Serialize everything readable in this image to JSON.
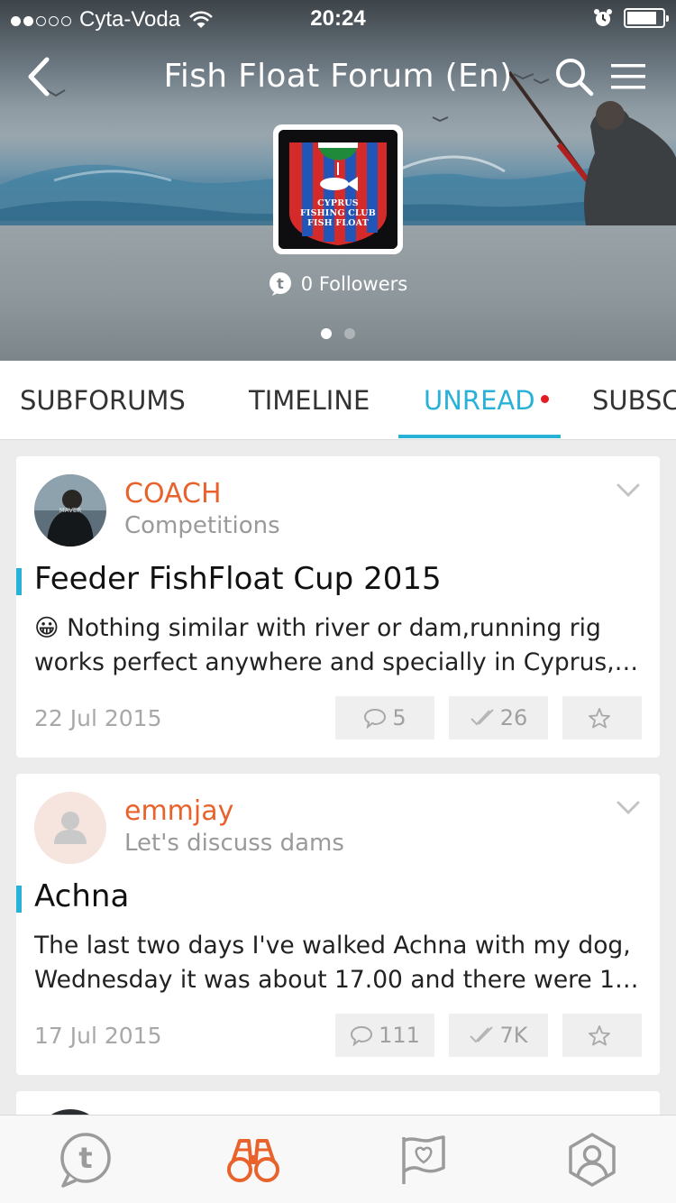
{
  "status_bar": {
    "carrier": "Cyta-Voda",
    "time": "20:24",
    "signal_bars_filled": 2,
    "signal_bars_total": 5,
    "battery_level": 0.85
  },
  "nav": {
    "title": "Fish Float Forum (En)",
    "back_icon": "chevron-left-icon",
    "search_icon": "search-icon",
    "menu_icon": "hamburger-menu-icon"
  },
  "forum": {
    "logo_text_lines": [
      "CYPRUS",
      "FISHING CLUB",
      "FISH FLOAT"
    ],
    "followers_label": "0 Followers",
    "pager_pages": 2,
    "pager_active": 0
  },
  "tabs": [
    {
      "label": "SUBFORUMS"
    },
    {
      "label": "TIMELINE"
    },
    {
      "label": "UNREAD",
      "active": true,
      "has_dot": true
    },
    {
      "label": "SUBSCRIBED"
    }
  ],
  "topics": [
    {
      "author": "COACH",
      "subforum": "Competitions",
      "title": "Feeder FishFloat Cup 2015",
      "emoji": "😀",
      "excerpt_line1": "Nothing similar with river or dam,running rig",
      "excerpt_line2": "works perfect anywhere and specially in Cyprus,l...",
      "date": "22 Jul 2015",
      "replies": "5",
      "views": "26"
    },
    {
      "author": "emmjay",
      "subforum": "Let's discuss dams",
      "title": "Achna",
      "emoji": "",
      "excerpt_line1": "The last two days I've walked Achna with my dog,",
      "excerpt_line2": "Wednesday it was about 17.00 and there were 12...",
      "date": "17 Jul 2015",
      "replies": "111",
      "views": "7K"
    }
  ],
  "bottom_bar": [
    {
      "icon": "tapatalk-icon",
      "active": false
    },
    {
      "icon": "binoculars-icon",
      "active": true
    },
    {
      "icon": "flag-heart-icon",
      "active": false
    },
    {
      "icon": "profile-icon",
      "active": false
    }
  ],
  "colors": {
    "accent_blue": "#2ab1d8",
    "author_orange": "#e8622c",
    "unread_dot": "#e31b23"
  }
}
